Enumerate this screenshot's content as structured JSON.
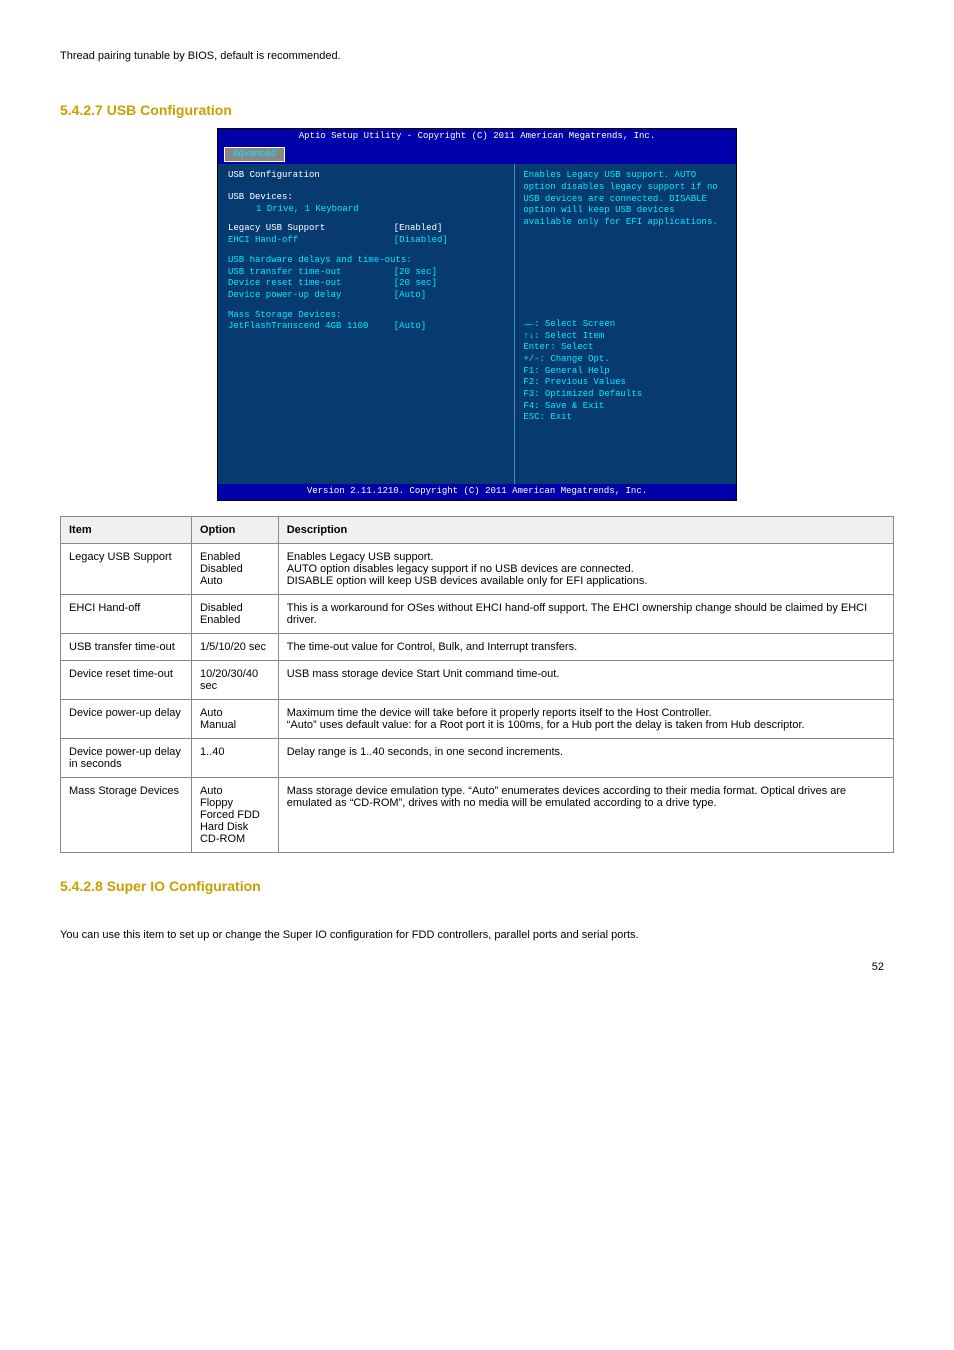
{
  "topNote": "Thread pairing tunable by BIOS, default is recommended.",
  "h1": "5.4.2.7 USB Configuration",
  "bios": {
    "topbar": "Aptio Setup Utility - Copyright (C) 2011 American Megatrends, Inc.",
    "tab": "Advanced",
    "sectionTitle": "USB Configuration",
    "usbDevicesLabel": "USB Devices:",
    "usbDevicesValue": "1 Drive, 1 Keyboard",
    "rows": [
      {
        "label": "Legacy USB Support",
        "value": "[Enabled]",
        "white": true
      },
      {
        "label": "EHCI Hand-off",
        "value": "[Disabled]"
      }
    ],
    "hwHeader": "USB hardware delays and time-outs:",
    "rows2": [
      {
        "label": "USB transfer time-out",
        "value": "[20 sec]"
      },
      {
        "label": "Device reset time-out",
        "value": "[20 sec]"
      },
      {
        "label": "Device power-up delay",
        "value": "[Auto]"
      }
    ],
    "massLabel": "Mass Storage Devices:",
    "massRow": {
      "label": "JetFlashTranscend 4GB 1100",
      "value": "[Auto]"
    },
    "helpText": "Enables Legacy USB support. AUTO option disables legacy support if no USB devices are connected. DISABLE option will keep USB devices available only for EFI applications.",
    "keys": [
      "→←: Select Screen",
      "↑↓: Select Item",
      "Enter: Select",
      "+/-: Change Opt.",
      "F1: General Help",
      "F2: Previous Values",
      "F3: Optimized Defaults",
      "F4: Save & Exit",
      "ESC: Exit"
    ],
    "footer": "Version 2.11.1210. Copyright (C) 2011 American Megatrends, Inc."
  },
  "table": {
    "headers": [
      "Item",
      "Option",
      "Description"
    ],
    "rows": [
      {
        "item": "Legacy USB Support",
        "option": "Enabled\nDisabled\nAuto",
        "desc": "Enables Legacy USB support.\nAUTO option disables legacy support if no USB devices are connected.\nDISABLE option will keep USB devices available only for EFI applications."
      },
      {
        "item": "EHCI Hand-off",
        "option": "Disabled\nEnabled",
        "desc": "This is a workaround for OSes without EHCI hand-off support. The EHCI ownership change should be claimed by EHCI driver."
      },
      {
        "item": "USB transfer time-out",
        "option": "1/5/10/20 sec",
        "desc": "The time-out value for Control, Bulk, and Interrupt transfers."
      },
      {
        "item": "Device reset time-out",
        "option": "10/20/30/40 sec",
        "desc": "USB mass storage device Start Unit command time-out."
      },
      {
        "item": "Device power-up delay",
        "option": "Auto\nManual",
        "desc": "Maximum time the device will take before it properly reports itself to the Host Controller.\n“Auto” uses default value: for a Root port it is 100ms, for a Hub port the delay is taken from Hub descriptor."
      },
      {
        "item": "Device power-up delay in seconds",
        "option": "1..40",
        "desc": "Delay range is 1..40 seconds, in one second increments."
      },
      {
        "item": "Mass Storage Devices",
        "option": "Auto\nFloppy\nForced FDD\nHard Disk\nCD-ROM",
        "desc": "Mass storage device emulation type. “Auto” enumerates devices according to their media format. Optical drives are emulated as “CD-ROM”, drives with no media will be emulated according to a drive type."
      }
    ]
  },
  "h2": "5.4.2.8 Super IO Configuration",
  "bottomNote": "You can use this item to set up or change the Super IO configuration for FDD controllers, parallel ports and serial ports.",
  "pageNum": "52"
}
